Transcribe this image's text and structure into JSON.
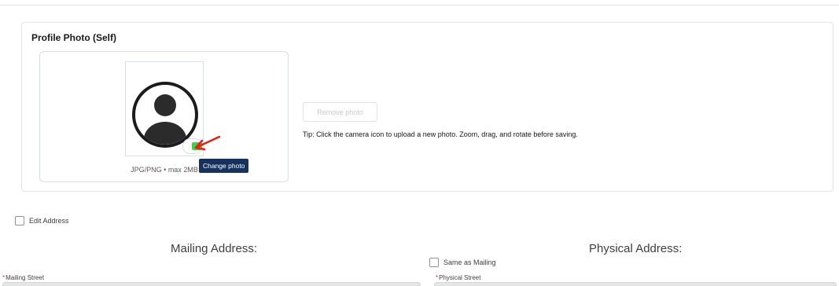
{
  "profile_photo": {
    "title": "Profile Photo (Self)",
    "caption": "JPG/PNG • max 2MB",
    "change_photo_tooltip": "Change photo",
    "remove_photo_label": "Remove photo",
    "tip": "Tip: Click the camera icon to upload a new photo. Zoom, drag, and rotate before saving."
  },
  "address": {
    "edit_address_label": "Edit Address",
    "edit_address_checked": false,
    "mailing_heading": "Mailing Address:",
    "physical_heading": "Physical Address:",
    "same_as_mailing_label": "Same as Mailing",
    "same_as_mailing_checked": false,
    "mailing_street_label": "Mailing Street",
    "physical_street_label": "Physical Street",
    "required_marker": "*"
  },
  "colors": {
    "required": "#c23934",
    "tooltip_bg": "#16325c",
    "annotation_arrow": "#e0201a",
    "camera_highlight": "#4bca4b"
  },
  "icons": {
    "avatar": "user-avatar-icon",
    "camera": "camera-icon",
    "arrow": "red-arrow-icon"
  }
}
